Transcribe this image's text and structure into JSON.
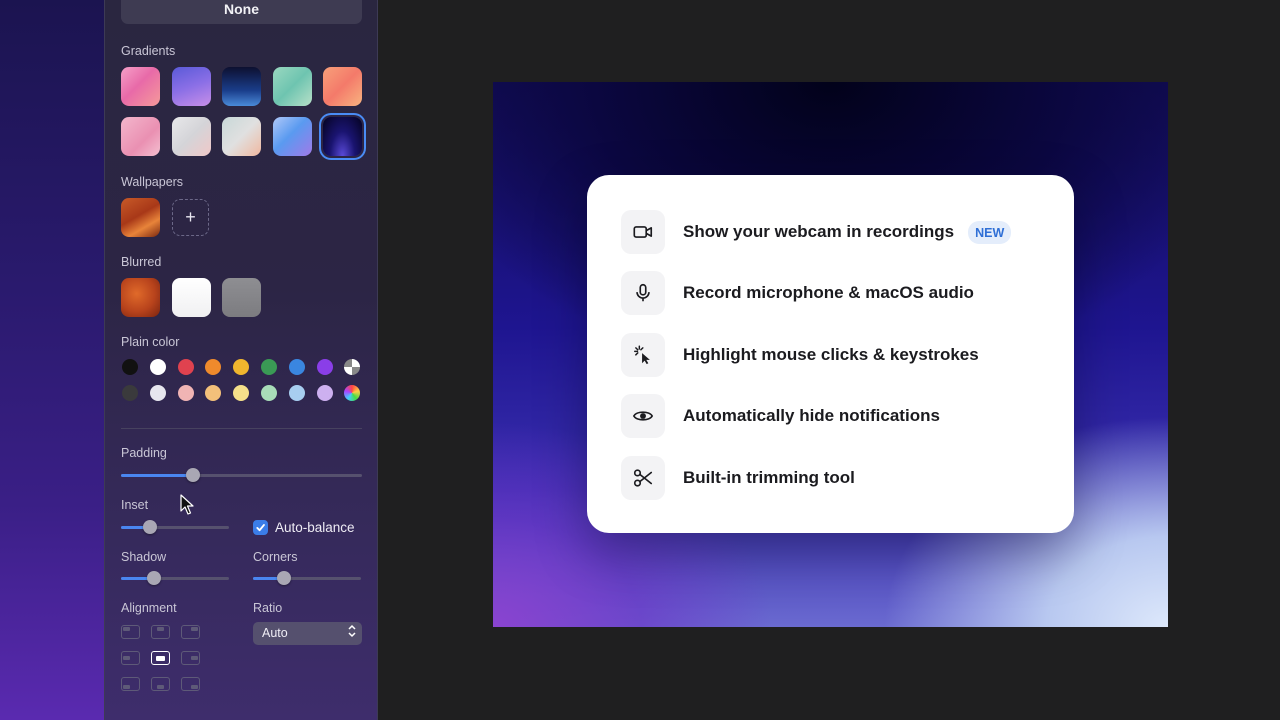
{
  "sidebar": {
    "none_label": "None",
    "gradients_label": "Gradients",
    "wallpapers_label": "Wallpapers",
    "add_wallpaper_label": "+",
    "blurred_label": "Blurred",
    "plain_color_label": "Plain color",
    "padding_label": "Padding",
    "inset_label": "Inset",
    "auto_balance_label": "Auto-balance",
    "auto_balance_checked": true,
    "shadow_label": "Shadow",
    "corners_label": "Corners",
    "alignment_label": "Alignment",
    "ratio_label": "Ratio",
    "ratio_value": "Auto",
    "selected_alignment": "center",
    "selected_gradient_index": 9,
    "slider_levels": {
      "padding": 0.3,
      "inset": 0.27,
      "shadow": 0.31,
      "corners": 0.29
    },
    "gradients": [
      "linear-gradient(135deg,#f6a0c8 0%,#e86aa8 45%,#f59a9a 100%)",
      "linear-gradient(160deg,#5a5ad8 0%,#8b6fe6 50%,#c88fe8 100%)",
      "linear-gradient(180deg,#0d1030 0%,#1a3d8a 60%,#4a8ad8 100%)",
      "linear-gradient(135deg,#9ad8c0 0%,#6ec4b0 50%,#b8e0c8 100%)",
      "linear-gradient(135deg,#f7a07a 0%,#f47a6a 50%,#f8b480 100%)",
      "linear-gradient(135deg,#f3b6cc 0%,#ea90b2 60%,#f4c0d0 100%)",
      "linear-gradient(135deg,#e8e8ea 0%,#d4d4d8 50%,#f0c8c8 100%)",
      "linear-gradient(135deg,#c8d8d8 0%,#e0e0e0 50%,#f0b8a0 100%)",
      "linear-gradient(135deg,#b0c8f8 0%,#5a9af0 45%,#a07ae8 100%)",
      "radial-gradient(ellipse at 50% 100%,#5a4ad8 0%,#1a1470 45%,#04021e 100%)"
    ],
    "blurred": [
      "radial-gradient(circle at 40% 40%,#e06a2a 0%,#b8431c 55%,#7a2410 100%)",
      "linear-gradient(180deg,#ffffff 0%,#f0f0f2 100%)",
      "linear-gradient(180deg,#8e8e92 0%,#7c7c80 100%)"
    ],
    "wallpaper": "linear-gradient(150deg,#c85a28 0%,#a83818 45%,#e8843a 70%,#7a2810 100%)",
    "plain_colors_row1": [
      "#111111",
      "#ffffff",
      "#e0424f",
      "#ef8a2c",
      "#f0b62e",
      "#3a9a55",
      "#3a86e0",
      "#8a3ee8",
      "checker"
    ],
    "plain_colors_row2": [
      "#3a3a3c",
      "#e6e6ee",
      "#f0b4b4",
      "#f3c07a",
      "#f5e08a",
      "#a8dcb8",
      "#a8cef0",
      "#cdb0f0",
      "rainbow"
    ]
  },
  "card": {
    "features": [
      {
        "text": "Show your webcam in recordings",
        "icon": "video-camera-icon",
        "badge": "NEW"
      },
      {
        "text": "Record microphone & macOS audio",
        "icon": "microphone-icon"
      },
      {
        "text": "Highlight mouse clicks & keystrokes",
        "icon": "cursor-click-icon"
      },
      {
        "text": "Automatically hide notifications",
        "icon": "eye-icon"
      },
      {
        "text": "Built-in trimming tool",
        "icon": "scissors-icon"
      }
    ]
  }
}
